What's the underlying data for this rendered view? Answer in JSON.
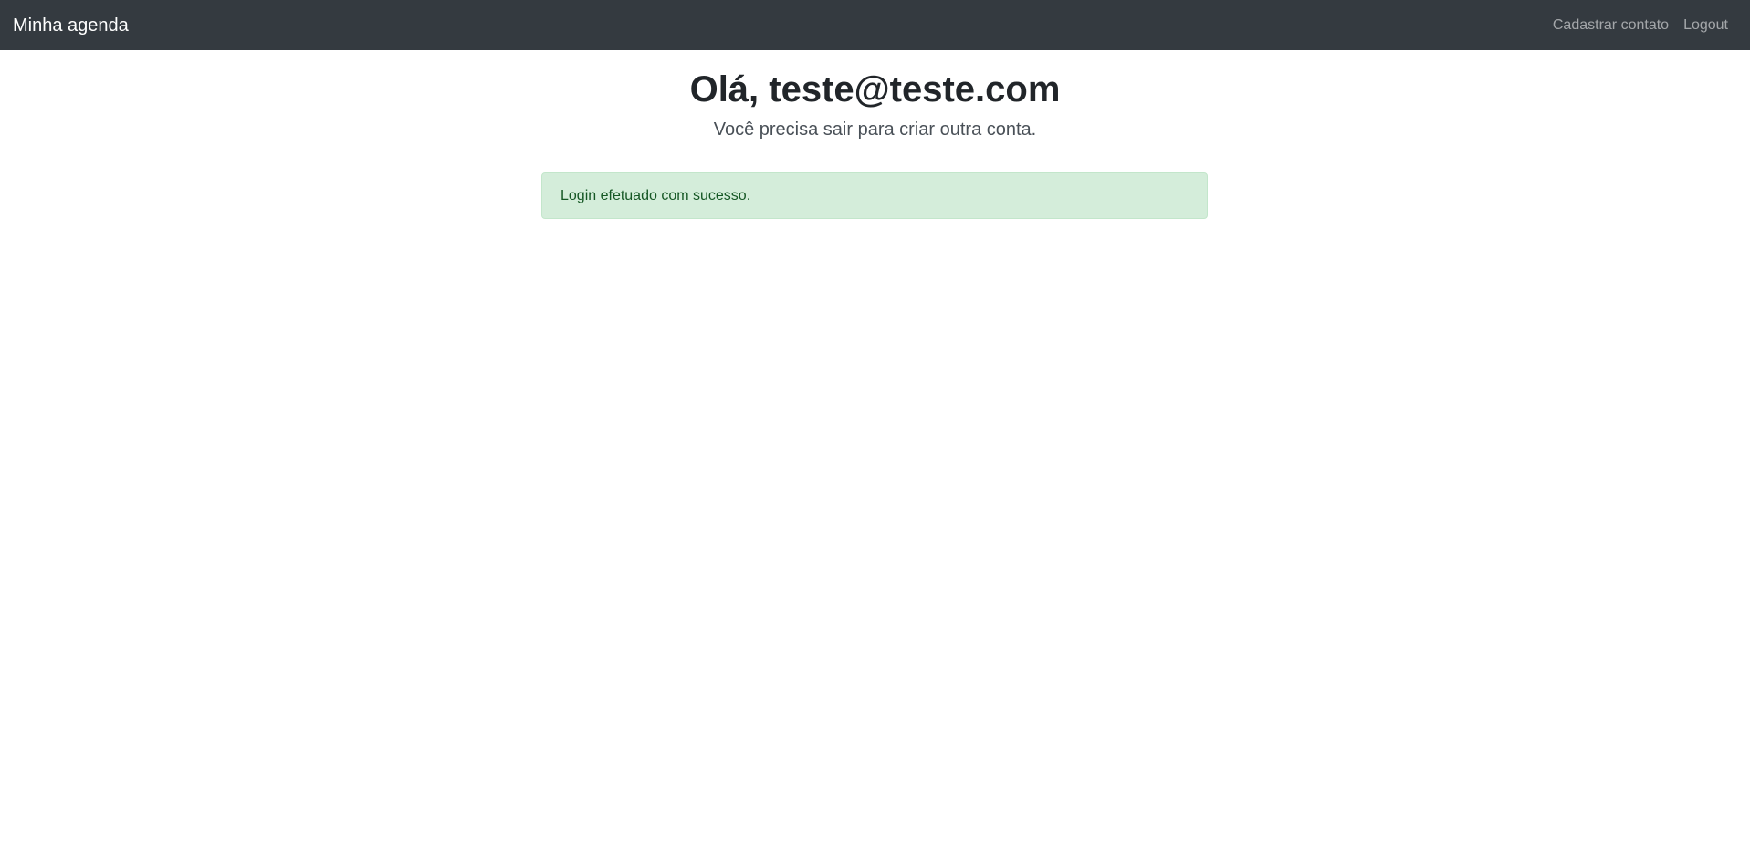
{
  "navbar": {
    "brand": "Minha agenda",
    "links": [
      {
        "label": "Cadastrar contato"
      },
      {
        "label": "Logout"
      }
    ]
  },
  "main": {
    "title": "Olá, teste@teste.com",
    "lead": "Você precisa sair para criar outra conta.",
    "alert": {
      "message": "Login efetuado com sucesso.",
      "type": "success"
    }
  },
  "colors": {
    "navbar_bg": "#343a40",
    "alert_success_bg": "#d4edda",
    "alert_success_text": "#155724"
  }
}
